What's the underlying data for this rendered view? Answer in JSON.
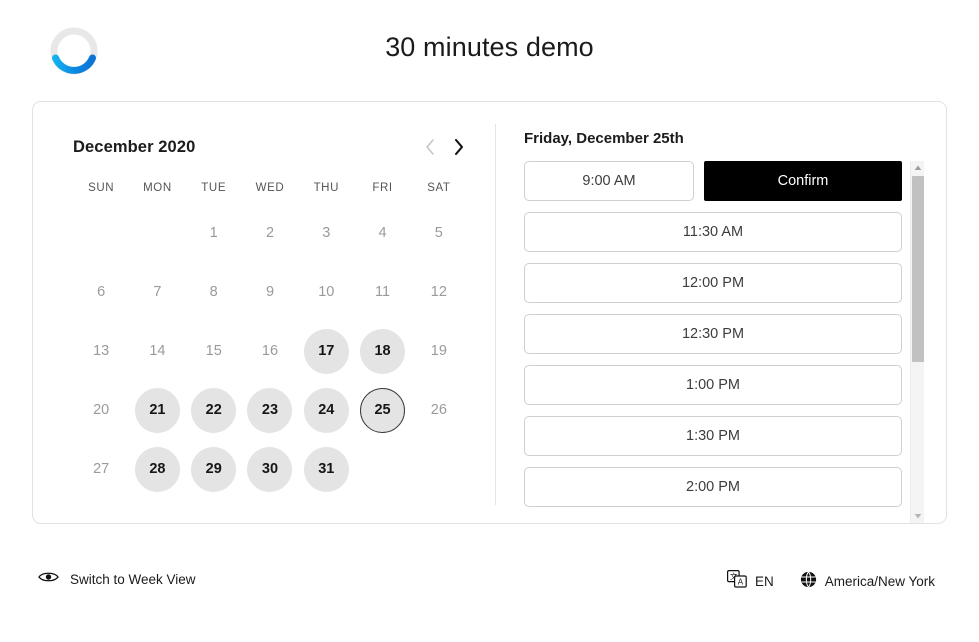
{
  "header": {
    "title": "30 minutes demo",
    "logo_icon": "loading-ring-icon",
    "logo_colors": {
      "track": "#e8e8e8",
      "arc_start": "#1aa3e8",
      "arc_end": "#0b74d8"
    }
  },
  "calendar": {
    "month_label": "December 2020",
    "prev_icon": "chevron-left-icon",
    "next_icon": "chevron-right-icon",
    "prev_enabled": false,
    "next_enabled": true,
    "weekdays": [
      "SUN",
      "MON",
      "TUE",
      "WED",
      "THU",
      "FRI",
      "SAT"
    ],
    "selected_day": 25,
    "colors": {
      "available_bg": "#e4e4e4",
      "available_text": "#161616",
      "disabled_text": "#9a9a9a",
      "selected_ring": "#3a3a3a"
    },
    "weeks": [
      [
        {
          "label": "",
          "state": "empty"
        },
        {
          "label": "",
          "state": "empty"
        },
        {
          "label": "1",
          "state": "disabled"
        },
        {
          "label": "2",
          "state": "disabled"
        },
        {
          "label": "3",
          "state": "disabled"
        },
        {
          "label": "4",
          "state": "disabled"
        },
        {
          "label": "5",
          "state": "disabled"
        }
      ],
      [
        {
          "label": "6",
          "state": "disabled"
        },
        {
          "label": "7",
          "state": "disabled"
        },
        {
          "label": "8",
          "state": "disabled"
        },
        {
          "label": "9",
          "state": "disabled"
        },
        {
          "label": "10",
          "state": "disabled"
        },
        {
          "label": "11",
          "state": "disabled"
        },
        {
          "label": "12",
          "state": "disabled"
        }
      ],
      [
        {
          "label": "13",
          "state": "disabled"
        },
        {
          "label": "14",
          "state": "disabled"
        },
        {
          "label": "15",
          "state": "disabled"
        },
        {
          "label": "16",
          "state": "disabled"
        },
        {
          "label": "17",
          "state": "available"
        },
        {
          "label": "18",
          "state": "available"
        },
        {
          "label": "19",
          "state": "disabled"
        }
      ],
      [
        {
          "label": "20",
          "state": "disabled"
        },
        {
          "label": "21",
          "state": "available"
        },
        {
          "label": "22",
          "state": "available"
        },
        {
          "label": "23",
          "state": "available"
        },
        {
          "label": "24",
          "state": "available"
        },
        {
          "label": "25",
          "state": "selected"
        },
        {
          "label": "26",
          "state": "disabled"
        }
      ],
      [
        {
          "label": "27",
          "state": "disabled"
        },
        {
          "label": "28",
          "state": "available"
        },
        {
          "label": "29",
          "state": "available"
        },
        {
          "label": "30",
          "state": "available"
        },
        {
          "label": "31",
          "state": "available"
        },
        {
          "label": "",
          "state": "empty"
        },
        {
          "label": "",
          "state": "empty"
        }
      ]
    ]
  },
  "slots": {
    "date_heading": "Friday, December 25th",
    "confirm_label": "Confirm",
    "selected_slot": "9:00 AM",
    "items": [
      {
        "label": "9:00 AM",
        "selected": true
      },
      {
        "label": "11:30 AM",
        "selected": false
      },
      {
        "label": "12:00 PM",
        "selected": false
      },
      {
        "label": "12:30 PM",
        "selected": false
      },
      {
        "label": "1:00 PM",
        "selected": false
      },
      {
        "label": "1:30 PM",
        "selected": false
      },
      {
        "label": "2:00 PM",
        "selected": false
      }
    ],
    "scrollbar": {
      "up_icon": "scroll-up-arrow-icon",
      "down_icon": "scroll-down-arrow-icon"
    }
  },
  "footer": {
    "week_view_label": "Switch to Week View",
    "week_view_icon": "eye-icon",
    "language_label": "EN",
    "language_icon": "translate-icon",
    "timezone_label": "America/New York",
    "timezone_icon": "globe-icon"
  }
}
